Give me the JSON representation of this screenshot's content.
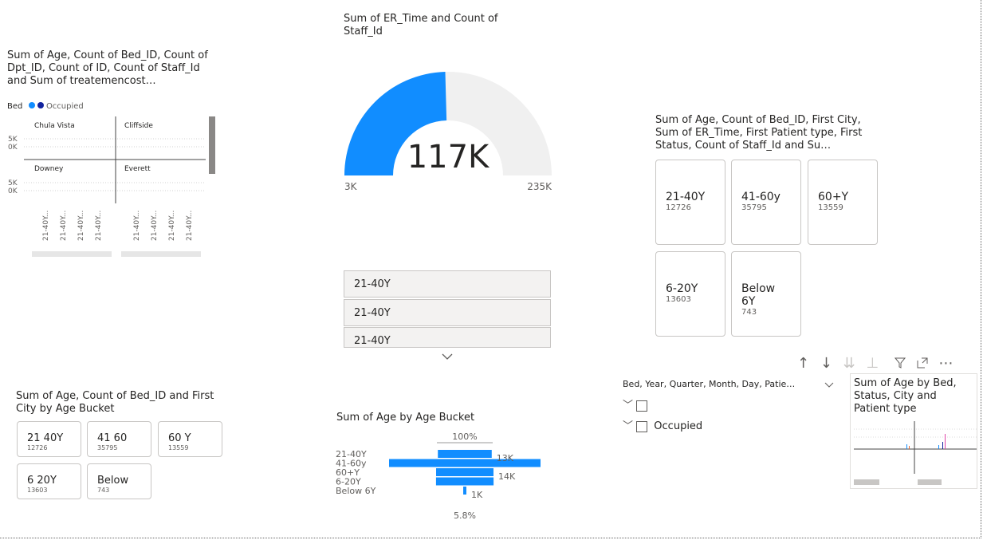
{
  "visual_small_multiples": {
    "title": "Sum of Age, Count of Bed_ID, Count of Dpt_ID, Count of ID, Count of Staff_Id and Sum of treatemencost…",
    "legend_label": "Bed",
    "legend_item": "Occupied",
    "panels": [
      "Chula Vista",
      "Cliffside",
      "Downey",
      "Everett"
    ],
    "y_ticks": [
      "5K",
      "0K"
    ],
    "x_ticks": [
      "21-40Y...",
      "21-40Y...",
      "21-40Y...",
      "21-40Y..."
    ]
  },
  "gauge": {
    "title": "Sum of ER_Time and Count of Staff_Id",
    "value_text": "117K",
    "min_label": "3K",
    "max_label": "235K",
    "value": 117,
    "min": 3,
    "max": 235
  },
  "slicer_list": {
    "items": [
      "21-40Y",
      "21-40Y",
      "21-40Y"
    ]
  },
  "multi_card": {
    "title": "Sum of Age, Count of Bed_ID, First City, Sum of ER_Time, First Patient type, First Status, Count of Staff_Id and Su…",
    "cards": [
      {
        "cat": "21-40Y",
        "val": "12726"
      },
      {
        "cat": "41-60y",
        "val": "35795"
      },
      {
        "cat": "60+Y",
        "val": "13559"
      },
      {
        "cat": "6-20Y",
        "val": "13603"
      },
      {
        "cat": "Below 6Y",
        "val": "743"
      }
    ]
  },
  "small_cards": {
    "title": "Sum of Age, Count of Bed_ID and First City by Age Bucket",
    "cards": [
      {
        "cat": "21 40Y",
        "val": "12726"
      },
      {
        "cat": "41 60",
        "val": "35795"
      },
      {
        "cat": "60 Y",
        "val": "13559"
      },
      {
        "cat": "6 20Y",
        "val": "13603"
      },
      {
        "cat": "Below",
        "val": "743"
      }
    ]
  },
  "funnel": {
    "title": "Sum of Age by Age Bucket",
    "top_pct": "100%",
    "bottom_pct": "5.8%"
  },
  "chart_data": {
    "type": "bar",
    "title": "Sum of Age by Age Bucket",
    "categories": [
      "21-40Y",
      "41-60y",
      "60+Y",
      "6-20Y",
      "Below 6Y"
    ],
    "values": [
      12726,
      35795,
      13559,
      13603,
      743
    ],
    "data_labels": [
      "13K",
      "",
      "14K",
      "",
      "1K"
    ]
  },
  "hierarchy_slicer": {
    "header": "Bed, Year, Quarter, Month, Day, Patie…",
    "items": [
      "",
      "Occupied"
    ]
  },
  "toolbar": {
    "icons": [
      "arrow-up-icon",
      "arrow-down-icon",
      "double-arrow-down-icon",
      "expand-hierarchy-icon",
      "filter-icon",
      "focus-mode-icon",
      "more-options-icon"
    ]
  },
  "mini_chart": {
    "title": "Sum of Age by Bed, Status, City and Patient type"
  },
  "colors": {
    "accent": "#118dff",
    "dark_blue": "#12239e",
    "panel_border": "#c8c6c4",
    "gauge_track": "#f0f0f0"
  }
}
